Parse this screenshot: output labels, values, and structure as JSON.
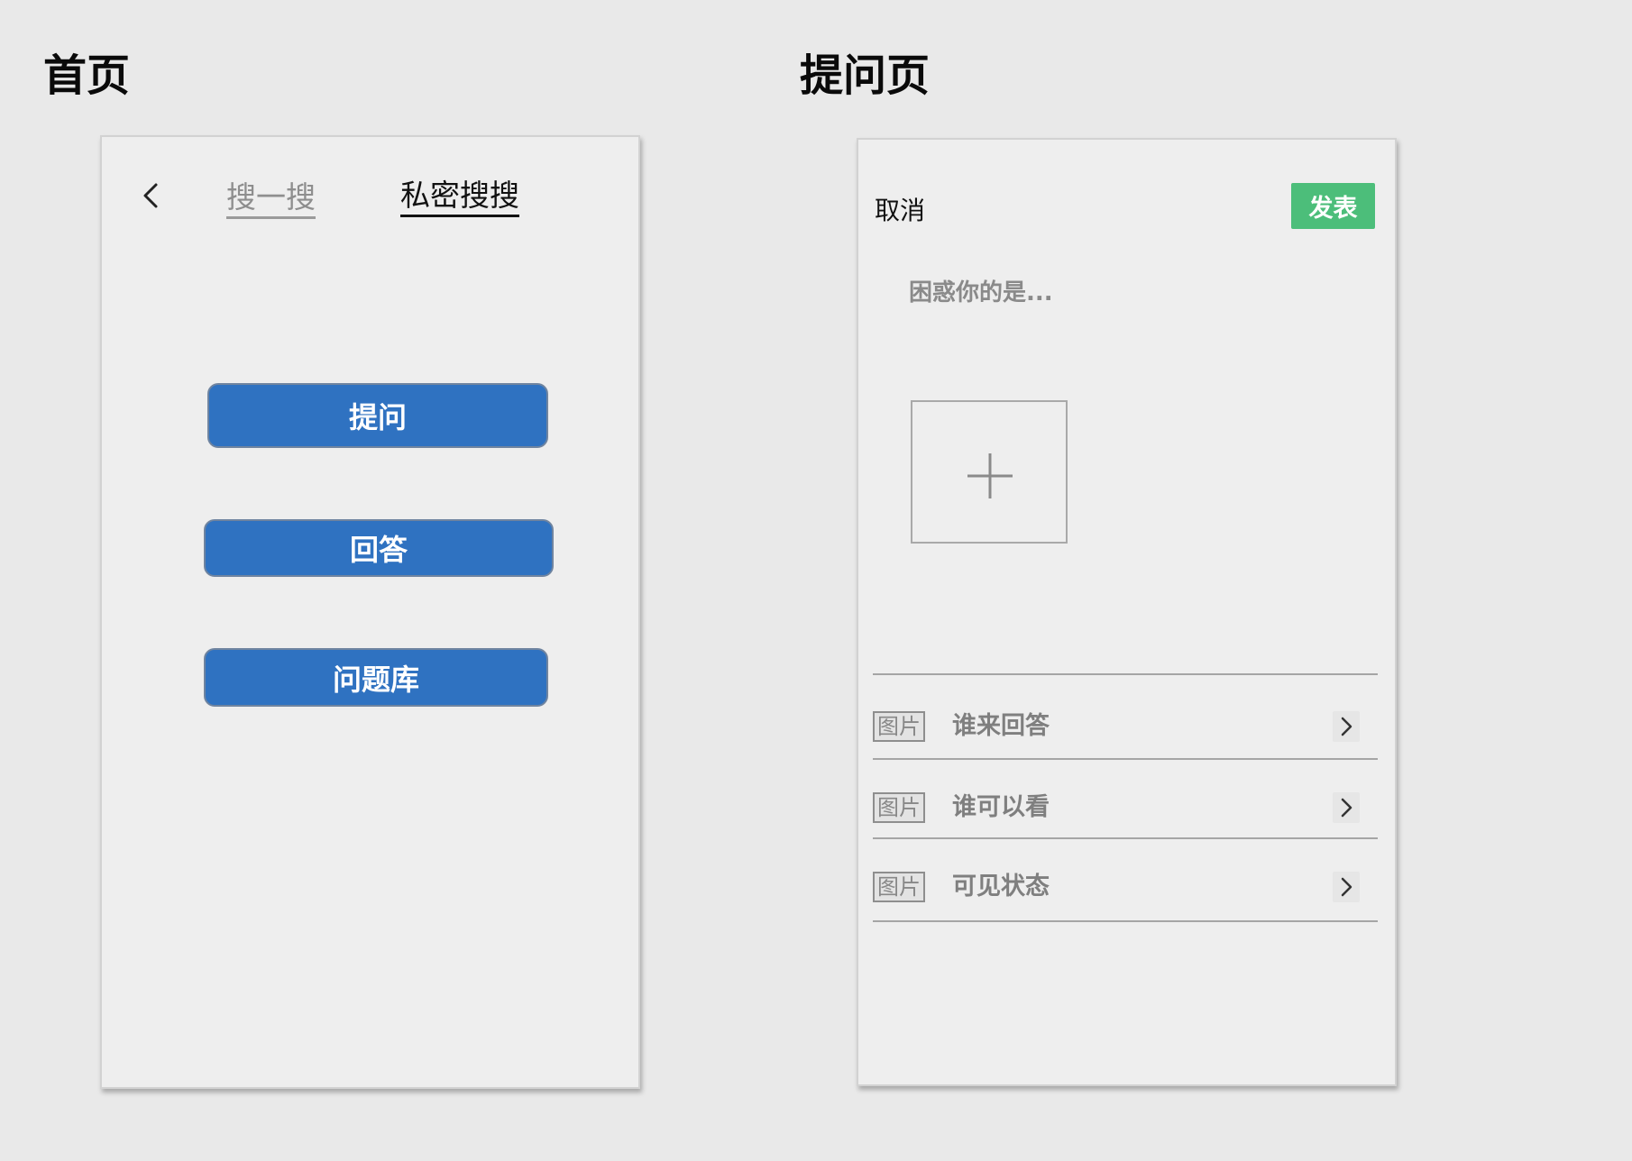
{
  "home": {
    "section_title": "首页",
    "tabs": [
      {
        "label": "搜一搜",
        "active": false
      },
      {
        "label": "私密搜搜",
        "active": true
      }
    ],
    "buttons": [
      {
        "label": "提问"
      },
      {
        "label": "回答"
      },
      {
        "label": "问题库"
      }
    ]
  },
  "ask": {
    "section_title": "提问页",
    "cancel_label": "取消",
    "publish_label": "发表",
    "question_placeholder": "困惑你的是...",
    "options": [
      {
        "badge": "图片",
        "label": "谁来回答"
      },
      {
        "badge": "图片",
        "label": "谁可以看"
      },
      {
        "badge": "图片",
        "label": "可见状态"
      }
    ]
  },
  "colors": {
    "page_background": "#e9e9e9",
    "frame_background": "#eeeeee",
    "primary_button": "#2f72c1",
    "publish_button": "#4cbe7a"
  },
  "icons": [
    "back-chevron-icon",
    "plus-icon",
    "chevron-right-icon"
  ]
}
